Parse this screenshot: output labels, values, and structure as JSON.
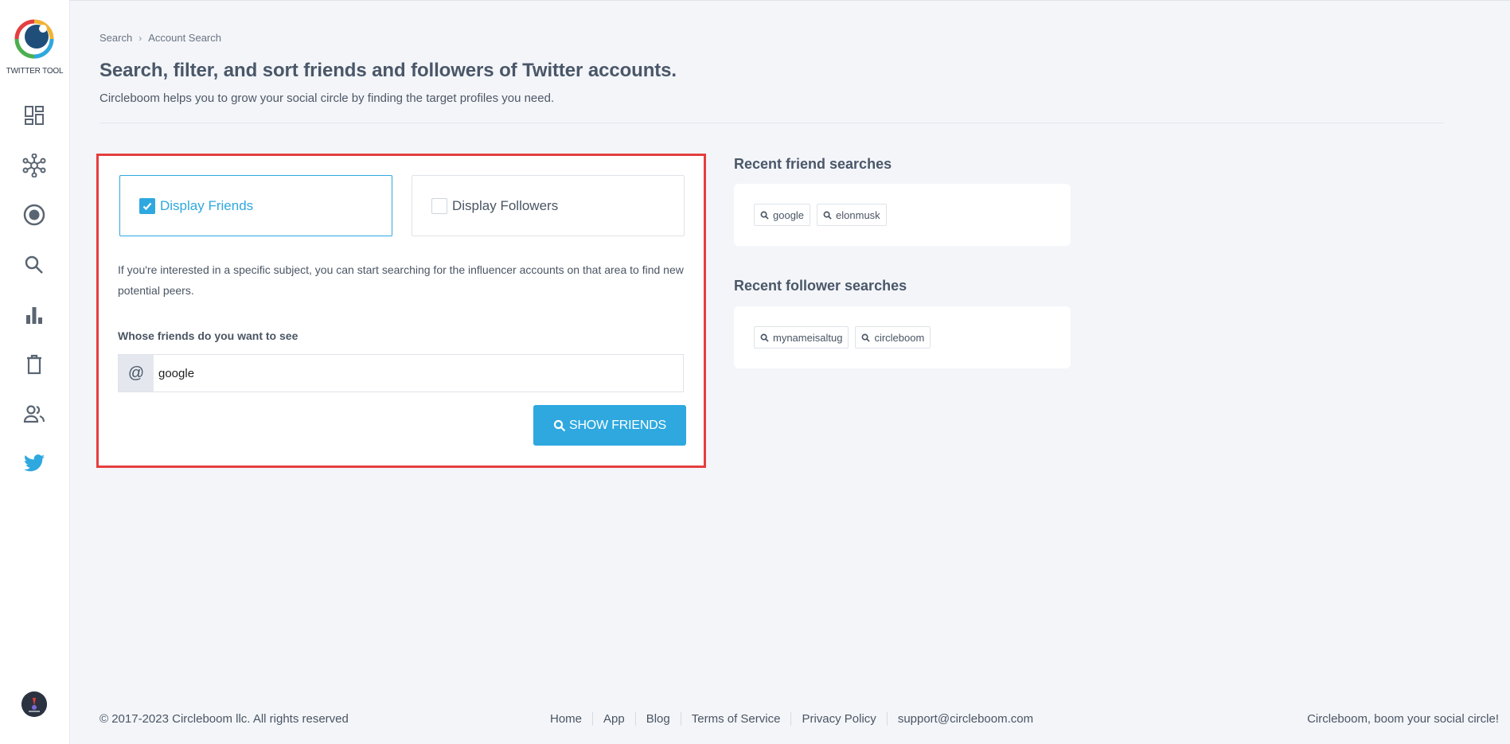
{
  "sidebar": {
    "logo_text": "TWITTER TOOL",
    "items": [
      {
        "name": "dashboard-icon"
      },
      {
        "name": "network-icon"
      },
      {
        "name": "target-icon"
      },
      {
        "name": "search-icon"
      },
      {
        "name": "bar-chart-icon"
      },
      {
        "name": "trash-icon"
      },
      {
        "name": "people-icon"
      },
      {
        "name": "twitter-icon"
      }
    ],
    "accent_color": "#2ea8df"
  },
  "breadcrumb": {
    "root": "Search",
    "current": "Account Search"
  },
  "header": {
    "title": "Search, filter, and sort friends and followers of Twitter accounts.",
    "subtitle": "Circleboom helps you to grow your social circle by finding the target profiles you need."
  },
  "form": {
    "display_friends_label": "Display Friends",
    "display_friends_checked": true,
    "display_followers_label": "Display Followers",
    "display_followers_checked": false,
    "info_text": "If you're interested in a specific subject, you can start searching for the influencer accounts on that area to find new potential peers.",
    "field_label": "Whose friends do you want to see",
    "input_prefix": "@",
    "input_value": "google",
    "button_label": "SHOW FRIENDS"
  },
  "recent_friends": {
    "title": "Recent friend searches",
    "chips": [
      "google",
      "elonmusk"
    ]
  },
  "recent_followers": {
    "title": "Recent follower searches",
    "chips": [
      "mynameisaltug",
      "circleboom"
    ]
  },
  "footer": {
    "copyright": "© 2017-2023 Circleboom llc. All rights reserved",
    "links": [
      "Home",
      "App",
      "Blog",
      "Terms of Service",
      "Privacy Policy",
      "support@circleboom.com"
    ],
    "tagline": "Circleboom, boom your social circle!"
  }
}
